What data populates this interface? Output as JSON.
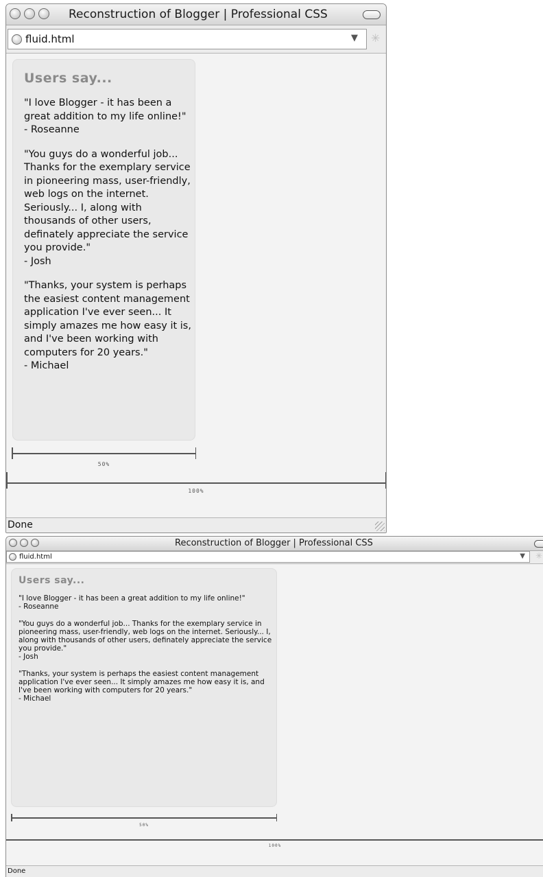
{
  "window": {
    "title": "Reconstruction of Blogger | Professional CSS",
    "url": "fluid.html",
    "status": "Done"
  },
  "sidebar": {
    "heading": "Users say...",
    "testimonials": [
      {
        "text": "\"I love Blogger - it has been a great addition to my life online!\"",
        "author": "- Roseanne"
      },
      {
        "text": "\"You guys do a wonderful job... Thanks for the exemplary service in pioneering mass, user-friendly, web logs on the internet. Seriously... I, along with thousands of other users, definately appreciate the service you provide.\"",
        "author": "- Josh"
      },
      {
        "text": "\"Thanks, your system is perhaps the easiest content management application I've ever seen... It simply amazes me how easy it is, and I've been working with computers for 20 years.\"",
        "author": "- Michael"
      }
    ]
  },
  "measures": {
    "half_label": "50%",
    "full_label": "100%"
  },
  "icons": {
    "window_buttons": [
      "close-icon",
      "minimize-icon",
      "zoom-icon"
    ],
    "page_icon": "globe-icon",
    "dropdown": "chevron-down-icon",
    "spinner": "loading-spinner-icon",
    "toolbar_toggle": "toolbar-toggle-pill"
  }
}
